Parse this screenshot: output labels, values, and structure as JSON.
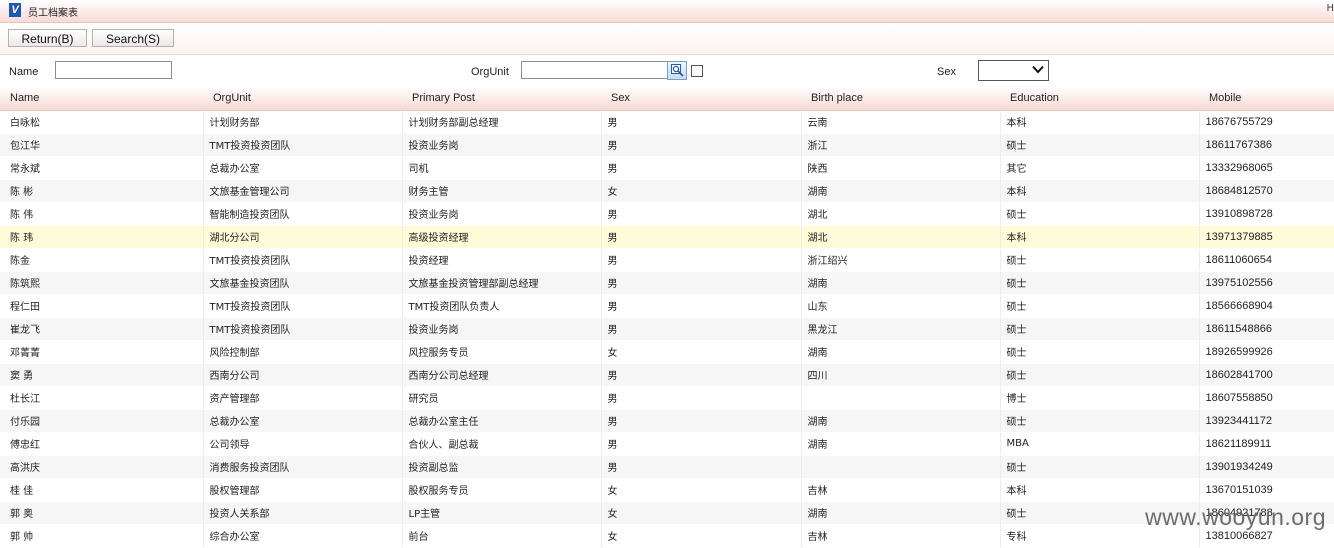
{
  "window": {
    "title": "员工档案表",
    "right_glyph": "H"
  },
  "toolbar": {
    "return_label": "Return(B)",
    "search_label": "Search(S)"
  },
  "filters": {
    "name_label": "Name",
    "name_value": "",
    "orgunit_label": "OrgUnit",
    "orgunit_value": "",
    "sex_label": "Sex",
    "sex_value": ""
  },
  "icons": {
    "lookup": "magnifier-lookup-icon",
    "dropdown": "chevron-down-icon",
    "logo": "app-logo-icon"
  },
  "table": {
    "columns": [
      "Name",
      "OrgUnit",
      "Primary Post",
      "Sex",
      "Birth place",
      "Education",
      "Mobile"
    ],
    "selected_row": 5,
    "rows": [
      [
        "白咏松",
        "计划财务部",
        "计划财务部副总经理",
        "男",
        "云南",
        "本科",
        "18676755729"
      ],
      [
        "包江华",
        "TMT投资投资团队",
        "投资业务岗",
        "男",
        "浙江",
        "硕士",
        "18611767386"
      ],
      [
        "常永斌",
        "总裁办公室",
        "司机",
        "男",
        "陕西",
        "其它",
        "13332968065"
      ],
      [
        "陈 彬",
        "文旅基金管理公司",
        "财务主管",
        "女",
        "湖南",
        "本科",
        "18684812570"
      ],
      [
        "陈 伟",
        "智能制造投资团队",
        "投资业务岗",
        "男",
        "湖北",
        "硕士",
        "13910898728"
      ],
      [
        "陈 玮",
        "湖北分公司",
        "高级投资经理",
        "男",
        "湖北",
        "本科",
        "13971379885"
      ],
      [
        "陈金",
        "TMT投资投资团队",
        "投资经理",
        "男",
        "浙江绍兴",
        "硕士",
        "18611060654"
      ],
      [
        "陈筑熙",
        "文旅基金投资团队",
        "文旅基金投资管理部副总经理",
        "男",
        "湖南",
        "硕士",
        "13975102556"
      ],
      [
        "程仁田",
        "TMT投资投资团队",
        "TMT投资团队负责人",
        "男",
        "山东",
        "硕士",
        "18566668904"
      ],
      [
        "崔龙飞",
        "TMT投资投资团队",
        "投资业务岗",
        "男",
        "黑龙江",
        "硕士",
        "18611548866"
      ],
      [
        "邓菁菁",
        "风险控制部",
        "风控服务专员",
        "女",
        "湖南",
        "硕士",
        "18926599926"
      ],
      [
        "窦 勇",
        "西南分公司",
        "西南分公司总经理",
        "男",
        "四川",
        "硕士",
        "18602841700"
      ],
      [
        "杜长江",
        "资产管理部",
        "研究员",
        "男",
        "",
        "博士",
        "18607558850"
      ],
      [
        "付乐园",
        "总裁办公室",
        "总裁办公室主任",
        "男",
        "湖南",
        "硕士",
        "13923441172"
      ],
      [
        "傅忠红",
        "公司领导",
        "合伙人、副总裁",
        "男",
        "湖南",
        "MBA",
        "18621189911"
      ],
      [
        "高洪庆",
        "消费服务投资团队",
        "投资副总监",
        "男",
        "",
        "硕士",
        "13901934249"
      ],
      [
        "桂 佳",
        "股权管理部",
        "股权服务专员",
        "女",
        "吉林",
        "本科",
        "13670151039"
      ],
      [
        "郭 奥",
        "投资人关系部",
        "LP主管",
        "女",
        "湖南",
        "硕士",
        "18604921788"
      ],
      [
        "郭 帅",
        "综合办公室",
        "前台",
        "女",
        "吉林",
        "专科",
        "13810066827"
      ]
    ]
  },
  "watermark": "www.wooyun.org"
}
